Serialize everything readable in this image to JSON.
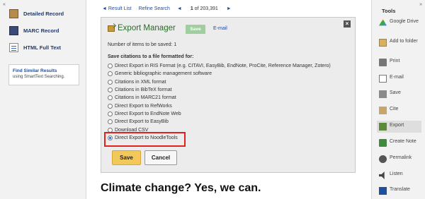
{
  "left_sidebar": {
    "collapse": "«",
    "items": [
      {
        "label": "Detailed Record",
        "icon": "detailed-record-icon"
      },
      {
        "label": "MARC Record",
        "icon": "marc-record-icon"
      },
      {
        "label": "HTML Full Text",
        "icon": "html-full-text-icon"
      }
    ],
    "similar": {
      "title": "Find Similar Results",
      "subtitle": "using SmartText Searching."
    }
  },
  "topnav": {
    "result_list": "◄ Result List",
    "refine_search": "Refine Search",
    "prev": "◄",
    "count": "1",
    "of": "of 203,391",
    "next": "►"
  },
  "modal": {
    "title": "Export Manager",
    "save_top": "Save",
    "email": "E-mail",
    "close": "×",
    "num_items": "Number of items to be saved: 1",
    "save_heading": "Save citations to a file formatted for:",
    "options": [
      {
        "label": "Direct Export in RIS Format (e.g. CITAVI, EasyBib, EndNote, ProCite, Reference Manager, Zotero)",
        "selected": false
      },
      {
        "label": "Generic bibliographic management software",
        "selected": false
      },
      {
        "label": "Citations in XML format",
        "selected": false
      },
      {
        "label": "Citations in BibTeX format",
        "selected": false
      },
      {
        "label": "Citations in MARC21 format",
        "selected": false
      },
      {
        "label": "Direct Export to RefWorks",
        "selected": false
      },
      {
        "label": "Direct Export to EndNote Web",
        "selected": false
      },
      {
        "label": "Direct Export to EasyBib",
        "selected": false
      },
      {
        "label": "Download CSV",
        "selected": false
      },
      {
        "label": "Direct Export to NoodleTools",
        "selected": true
      }
    ],
    "save_button": "Save",
    "cancel_button": "Cancel",
    "highlight_color": "#e0211c"
  },
  "headline": "Climate change? Yes, we can.",
  "tools": {
    "collapse": "»",
    "heading": "Tools",
    "items": [
      {
        "label": "Google Drive",
        "icon": "google-drive-icon",
        "active": false
      },
      {
        "label": "Add to folder",
        "icon": "folder-icon",
        "active": false
      },
      {
        "label": "Print",
        "icon": "print-icon",
        "active": false
      },
      {
        "label": "E-mail",
        "icon": "email-icon",
        "active": false
      },
      {
        "label": "Save",
        "icon": "save-icon",
        "active": false
      },
      {
        "label": "Cite",
        "icon": "cite-icon",
        "active": false
      },
      {
        "label": "Export",
        "icon": "export-icon",
        "active": true
      },
      {
        "label": "Create Note",
        "icon": "create-note-icon",
        "active": false
      },
      {
        "label": "Permalink",
        "icon": "permalink-icon",
        "active": false
      },
      {
        "label": "Listen",
        "icon": "listen-icon",
        "active": false
      },
      {
        "label": "Translate",
        "icon": "translate-icon",
        "active": false
      }
    ]
  }
}
